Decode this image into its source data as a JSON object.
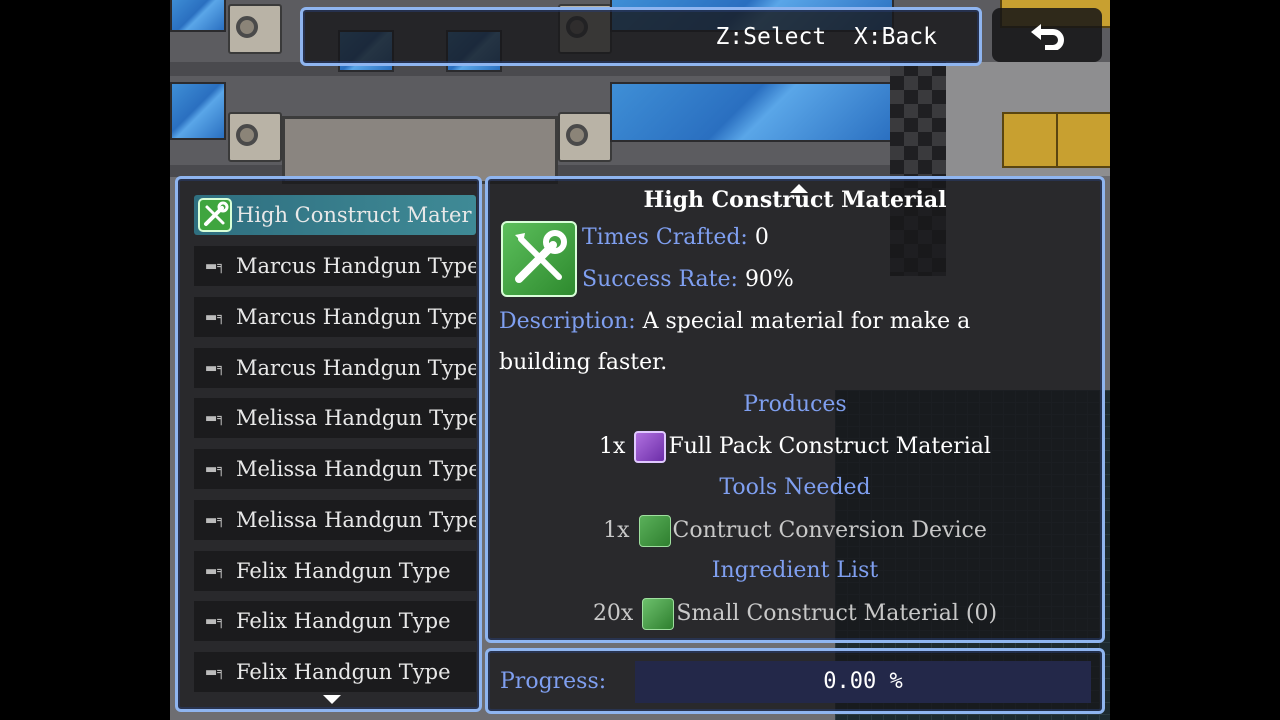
{
  "help": {
    "text": "Z:Select  X:Back"
  },
  "back_button": {
    "icon": "return-arrow-icon"
  },
  "recipe_list": {
    "items": [
      {
        "label": "High Construct Mater",
        "icon": "wrench-screwdriver-icon",
        "selected": true
      },
      {
        "label": "Marcus Handgun Type",
        "icon": "handgun-icon"
      },
      {
        "label": "Marcus Handgun Type",
        "icon": "handgun-icon"
      },
      {
        "label": "Marcus Handgun Type",
        "icon": "handgun-icon"
      },
      {
        "label": "Melissa Handgun Type",
        "icon": "handgun-icon"
      },
      {
        "label": "Melissa Handgun Type",
        "icon": "handgun-icon"
      },
      {
        "label": "Melissa Handgun Type",
        "icon": "handgun-icon"
      },
      {
        "label": "Felix Handgun Type",
        "icon": "handgun-icon"
      },
      {
        "label": "Felix Handgun Type",
        "icon": "handgun-icon"
      },
      {
        "label": "Felix Handgun Type",
        "icon": "handgun-icon"
      }
    ]
  },
  "detail": {
    "title": "High Construct Material",
    "times_crafted_label": "Times Crafted:",
    "times_crafted_value": "0",
    "success_rate_label": "Success Rate:",
    "success_rate_value": "90%",
    "description_label": "Description:",
    "description_line1": "A special material for make a",
    "description_line2": "building faster.",
    "produces_heading": "Produces",
    "produces_qty": "1x",
    "produces_item": "Full Pack Construct Material",
    "tools_heading": "Tools Needed",
    "tool_qty": "1x",
    "tool_item": "Contruct Conversion Device",
    "ingredients_heading": "Ingredient List",
    "ingredient_qty": "20x",
    "ingredient_item": "Small Construct Material (0)"
  },
  "progress": {
    "label": "Progress:",
    "value_text": "0.00 %",
    "fraction": 0
  },
  "colors": {
    "window_border": "#8fb5f0",
    "label_blue": "#7f9ff0",
    "selection": "#3f8a96",
    "progress_track": "#232849"
  }
}
